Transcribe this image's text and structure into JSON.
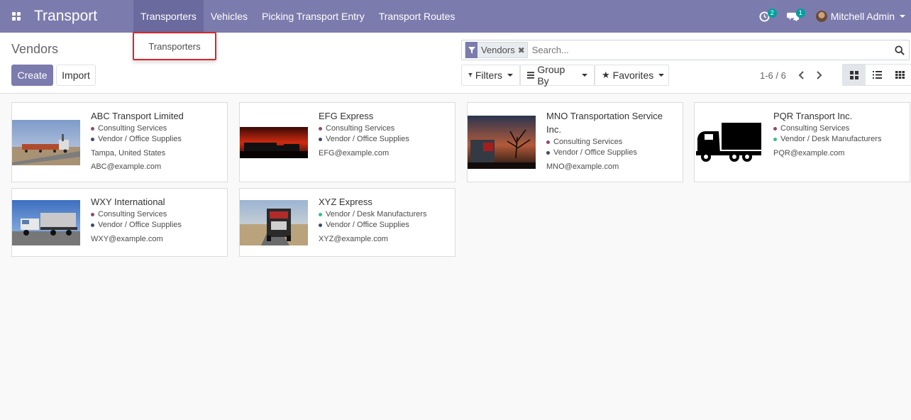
{
  "app": {
    "title": "Transport"
  },
  "nav": {
    "items": [
      {
        "label": "Transporters"
      },
      {
        "label": "Vehicles"
      },
      {
        "label": "Picking Transport Entry"
      },
      {
        "label": "Transport Routes"
      }
    ],
    "activity_count": "2",
    "message_count": "1",
    "user_name": "Mitchell Admin"
  },
  "dropdown": {
    "item_label": "Transporters"
  },
  "control": {
    "breadcrumb": "Vendors",
    "create_label": "Create",
    "import_label": "Import",
    "search_facet": "Vendors",
    "search_placeholder": "Search...",
    "filters_label": "Filters",
    "group_by_label": "Group By",
    "favorites_label": "Favorites",
    "pager": "1-6 / 6"
  },
  "colors": {
    "navbar": "#7c7bad",
    "tag_consulting": "#8c4a6e",
    "tag_office": "#3d4a6b",
    "tag_desk": "#30c381"
  },
  "cards": [
    {
      "name": "ABC Transport Limited",
      "tags": [
        {
          "label": "Consulting Services",
          "color": "#8c4a6e"
        },
        {
          "label": "Vendor / Office Supplies",
          "color": "#3d4a6b"
        }
      ],
      "location": "Tampa, United States",
      "email": "ABC@example.com",
      "image": "road-train-photo"
    },
    {
      "name": "EFG Express",
      "tags": [
        {
          "label": "Consulting Services",
          "color": "#8c4a6e"
        },
        {
          "label": "Vendor / Office Supplies",
          "color": "#3d4a6b"
        }
      ],
      "email": "EFG@example.com",
      "image": "sunset-truck-photo"
    },
    {
      "name": "MNO Transportation Service Inc.",
      "tags": [
        {
          "label": "Consulting Services",
          "color": "#8c4a6e"
        },
        {
          "label": "Vendor / Office Supplies",
          "color": "#3d4a6b"
        }
      ],
      "email": "MNO@example.com",
      "image": "tree-truck-photo"
    },
    {
      "name": "PQR Transport Inc.",
      "tags": [
        {
          "label": "Consulting Services",
          "color": "#8c4a6e"
        },
        {
          "label": "Vendor / Desk Manufacturers",
          "color": "#30c381"
        }
      ],
      "email": "PQR@example.com",
      "image": "truck-silhouette-icon"
    },
    {
      "name": "WXY International",
      "tags": [
        {
          "label": "Consulting Services",
          "color": "#8c4a6e"
        },
        {
          "label": "Vendor / Office Supplies",
          "color": "#3d4a6b"
        }
      ],
      "email": "WXY@example.com",
      "image": "flatbed-truck-photo"
    },
    {
      "name": "XYZ Express",
      "tags": [
        {
          "label": "Vendor / Desk Manufacturers",
          "color": "#30c381"
        },
        {
          "label": "Vendor / Office Supplies",
          "color": "#3d4a6b"
        }
      ],
      "email": "XYZ@example.com",
      "image": "highway-truck-photo"
    }
  ]
}
